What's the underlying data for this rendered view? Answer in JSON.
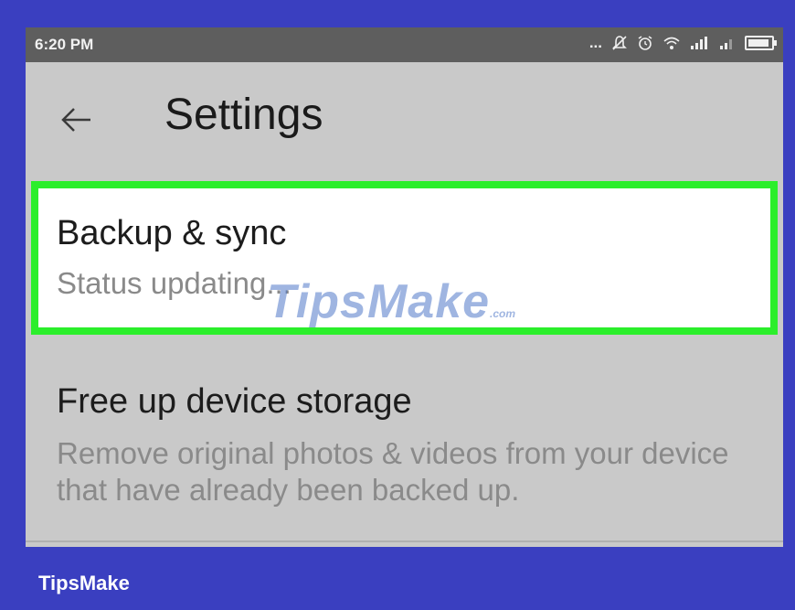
{
  "status_bar": {
    "time": "6:20 PM",
    "more_dots": "...",
    "icons": [
      "mute-bell-icon",
      "alarm-icon",
      "wifi-icon",
      "signal-icon",
      "signal-icon",
      "battery-icon"
    ],
    "battery_level": 0.9
  },
  "appbar": {
    "back_icon": "arrow-left-icon",
    "title": "Settings"
  },
  "settings": [
    {
      "title": "Backup & sync",
      "subtitle": "Status updating...",
      "highlighted": true,
      "highlight_color": "#2bee2b"
    },
    {
      "title": "Free up device storage",
      "subtitle": "Remove original photos & videos from your device that have already been backed up."
    }
  ],
  "watermark": {
    "text": "TipsMake",
    "suffix": ".com"
  },
  "footer": {
    "brand": "TipsMake"
  },
  "colors": {
    "frame": "#3a3fc0",
    "screen": "#c9c9c9",
    "status_bar": "#5e5e5e",
    "highlight": "#2bee2b"
  }
}
